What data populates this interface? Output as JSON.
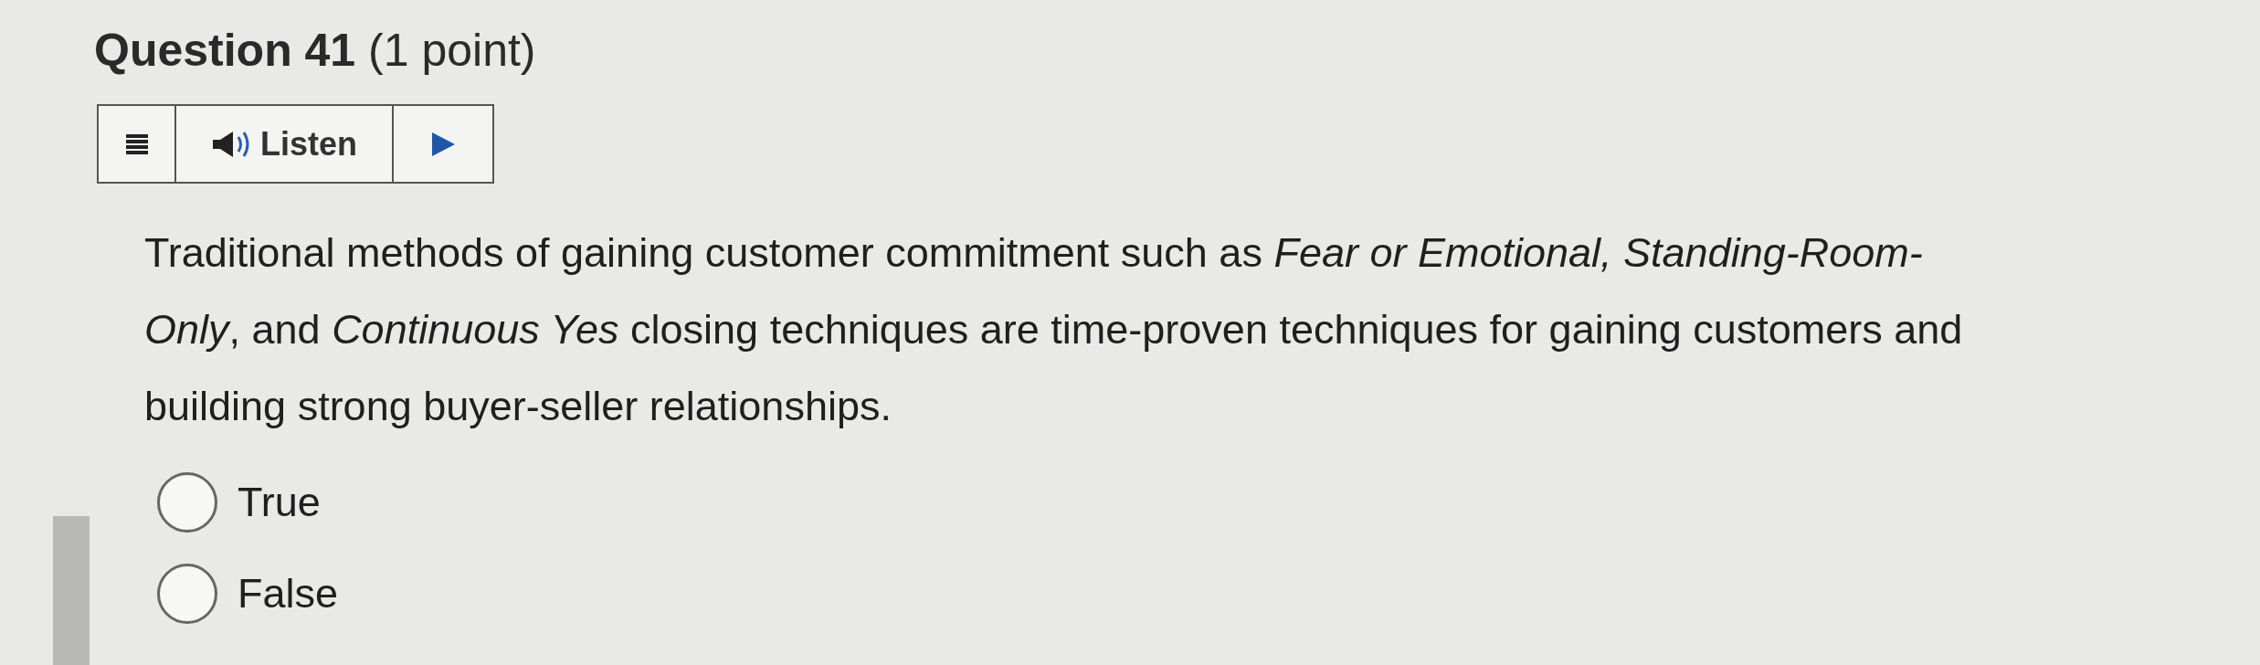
{
  "question": {
    "title": "Question 41",
    "points": "(1 point)"
  },
  "toolbar": {
    "listen": "Listen"
  },
  "prompt": "Traditional methods of gaining customer commitment such as *Fear or Emotional, Standing-Room-Only*, and *Continuous Yes* closing techniques are time-proven techniques for gaining customers and building strong buyer-seller relationships.",
  "options": [
    {
      "label": "True",
      "selected": false
    },
    {
      "label": "False",
      "selected": false
    }
  ]
}
